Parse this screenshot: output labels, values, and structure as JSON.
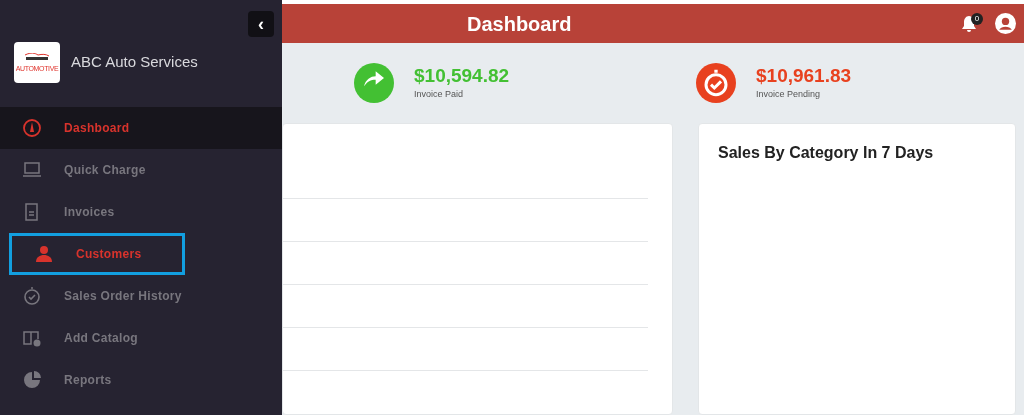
{
  "sidebar": {
    "collapse_button": "‹",
    "brand": "ABC Auto Services",
    "logo_text": "AUTOMOTIVE",
    "items": [
      {
        "label": "Dashboard",
        "kind": "gauge",
        "selected": true,
        "highlighted": false
      },
      {
        "label": "Quick Charge",
        "kind": "monitor",
        "selected": false,
        "highlighted": false
      },
      {
        "label": "Invoices",
        "kind": "invoice",
        "selected": false,
        "highlighted": false
      },
      {
        "label": "Customers",
        "kind": "person",
        "selected": false,
        "highlighted": true
      },
      {
        "label": "Sales Order History",
        "kind": "timer",
        "selected": false,
        "highlighted": false
      },
      {
        "label": "Add Catalog",
        "kind": "book",
        "selected": false,
        "highlighted": false
      },
      {
        "label": "Reports",
        "kind": "pie",
        "selected": false,
        "highlighted": false
      }
    ]
  },
  "header": {
    "title": "Dashboard",
    "notification_count": "0"
  },
  "stats": [
    {
      "amount": "$10,594.82",
      "label": "Invoice Paid",
      "color": "#43c033",
      "kind": "forward"
    },
    {
      "amount": "$10,961.83",
      "label": "Invoice Pending",
      "color": "#e8411f",
      "kind": "timer"
    }
  ],
  "cards": [
    {
      "title": "Sales By Category In 7 Days"
    }
  ]
}
